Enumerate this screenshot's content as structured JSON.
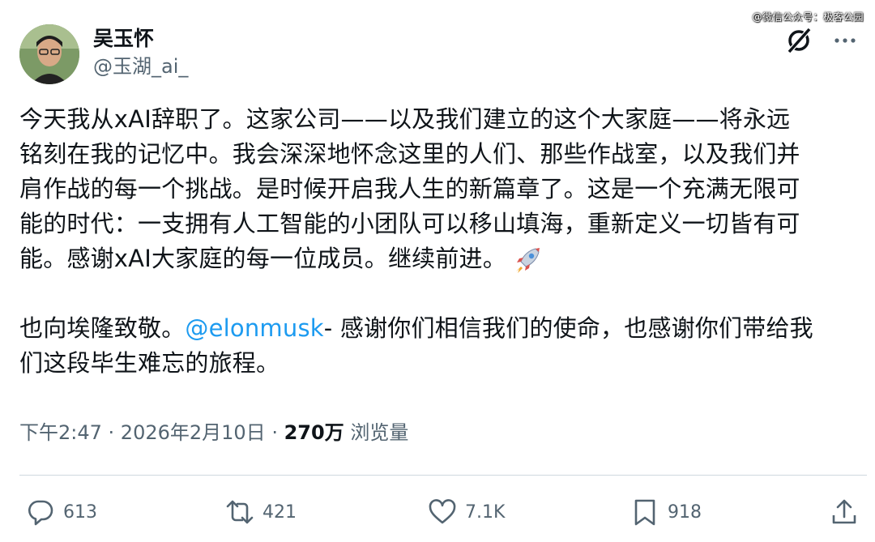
{
  "watermark": "@微信公众号：极客公园",
  "author": {
    "display_name": "吴玉怀",
    "handle": "@玉湖_ai_"
  },
  "icons": {
    "grok": "grok-icon",
    "more": "more-dots-icon",
    "rocket": "rocket-emoji-icon",
    "reply": "reply-icon",
    "repost": "repost-icon",
    "like": "heart-icon",
    "bookmark": "bookmark-icon",
    "share": "share-icon"
  },
  "post": {
    "line1": "今天我从xAI辞职了。这家公司——以及我们建立的这个大家庭——将永远",
    "line2": "铭刻在我的记忆中。我会深深地怀念这里的人们、那些作战室，以及我们并",
    "line3": "肩作战的每一个挑战。是时候开启我人生的新篇章了。这是一个充满无限可",
    "line4": "能的时代：一支拥有人工智能的小团队可以移山填海，重新定义一切皆有可",
    "line5": "能。感谢xAI大家庭的每一位成员。继续前进。",
    "para2_prefix": "也向埃隆致敬。",
    "mention": "@elonmusk",
    "para2_rest": "- 感谢你们相信我们的使命，也感谢你们带给我",
    "para2_line2": "们这段毕生难忘的旅程。"
  },
  "meta": {
    "time": "下午2:47",
    "sep1": " · ",
    "date": "2026年2月10日",
    "sep2": " · ",
    "views_count": "270万",
    "views_label": " 浏览量"
  },
  "actions": {
    "replies": "613",
    "reposts": "421",
    "likes": "7.1K",
    "bookmarks": "918"
  }
}
